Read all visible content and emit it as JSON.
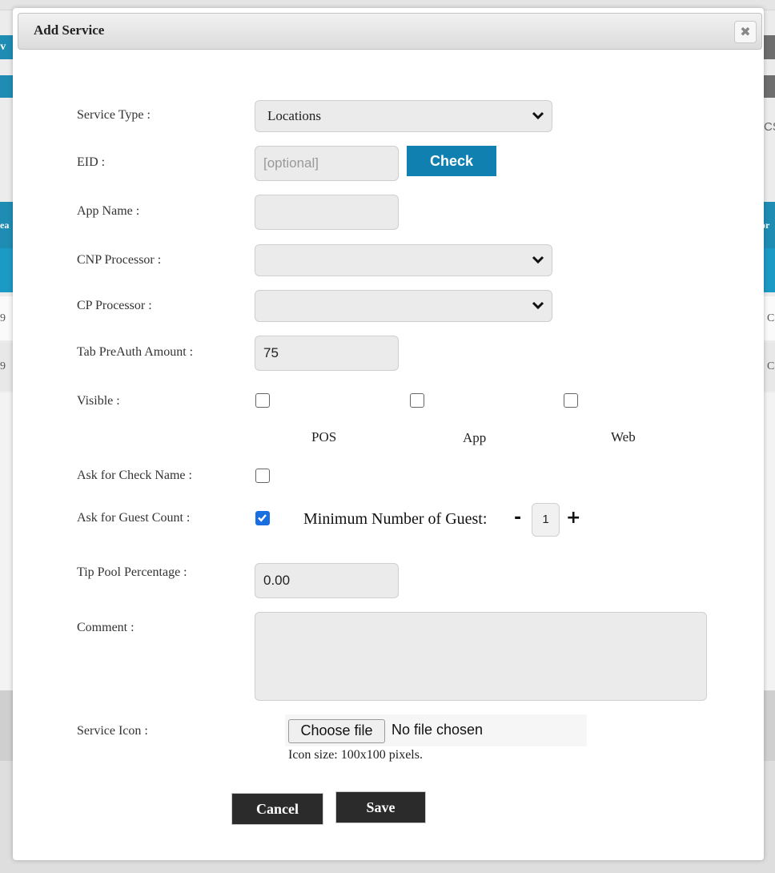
{
  "background": {
    "left_fragment_1": "ev",
    "left_fragment_2": "ea",
    "left_row_1": "9",
    "left_row_2": "9",
    "right_fragment_cs": "CS",
    "right_fragment_or": "or",
    "right_row_1": "C",
    "right_row_2": "C"
  },
  "modal": {
    "title": "Add Service",
    "close_icon": "close-icon",
    "fields": {
      "service_type": {
        "label": "Service Type :",
        "value": "Locations"
      },
      "eid": {
        "label": "EID :",
        "placeholder": "[optional]",
        "check_label": "Check"
      },
      "app_name": {
        "label": "App Name :",
        "value": ""
      },
      "cnp_processor": {
        "label": "CNP Processor :",
        "value": ""
      },
      "cp_processor": {
        "label": "CP Processor :",
        "value": ""
      },
      "tab_preauth": {
        "label": "Tab PreAuth Amount :",
        "value": "75"
      },
      "visible": {
        "label": "Visible :",
        "options": [
          {
            "label": "POS",
            "checked": false
          },
          {
            "label": "App",
            "checked": false
          },
          {
            "label": "Web",
            "checked": false
          }
        ]
      },
      "ask_check_name": {
        "label": "Ask for Check Name :",
        "checked": false
      },
      "ask_guest_count": {
        "label": "Ask for Guest Count :",
        "checked": true,
        "min_guest_label": "Minimum Number of Guest:",
        "min_guest_value": "1",
        "minus": "-",
        "plus": "+"
      },
      "tip_pool": {
        "label": "Tip Pool Percentage :",
        "value": "0.00"
      },
      "comment": {
        "label": "Comment :",
        "value": ""
      },
      "service_icon": {
        "label": "Service Icon :",
        "button_label": "Choose file",
        "status": "No file chosen",
        "hint": "Icon size: 100x100 pixels."
      }
    },
    "buttons": {
      "cancel": "Cancel",
      "save": "Save"
    }
  },
  "colors": {
    "accent": "#1080b0",
    "checkbox_checked": "#1a6fe0",
    "dark_button": "#2b2b2b"
  }
}
